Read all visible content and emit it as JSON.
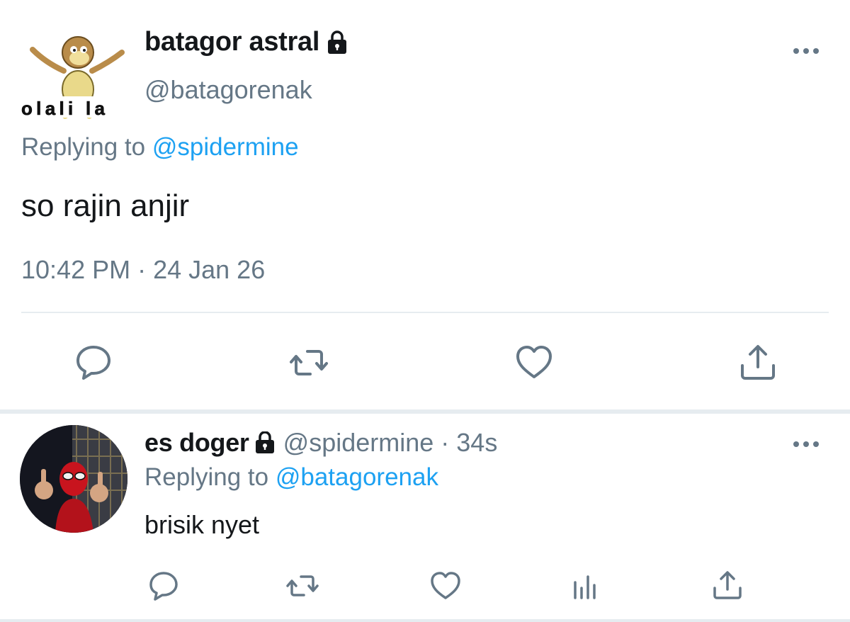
{
  "main_tweet": {
    "display_name": "batagor astral",
    "handle": "@batagorenak",
    "avatar_caption": "olali la",
    "replying_prefix": "Replying to",
    "replying_to": "@spidermine",
    "text": "so rajin anjir",
    "timestamp": "10:42 PM · 24 Jan 26",
    "actions": [
      "reply-icon",
      "retweet-icon",
      "like-icon",
      "share-icon"
    ]
  },
  "reply_tweet": {
    "display_name": "es doger",
    "handle": "@spidermine",
    "separator": "·",
    "time_ago": "34s",
    "replying_prefix": "Replying to",
    "replying_to": "@batagorenak",
    "text": "brisik nyet",
    "actions": [
      "reply-icon",
      "retweet-icon",
      "like-icon",
      "analytics-icon",
      "share-icon"
    ]
  },
  "colors": {
    "text_primary": "#14171a",
    "text_secondary": "#657786",
    "link": "#1da1f2",
    "divider": "#e6ecf0"
  }
}
